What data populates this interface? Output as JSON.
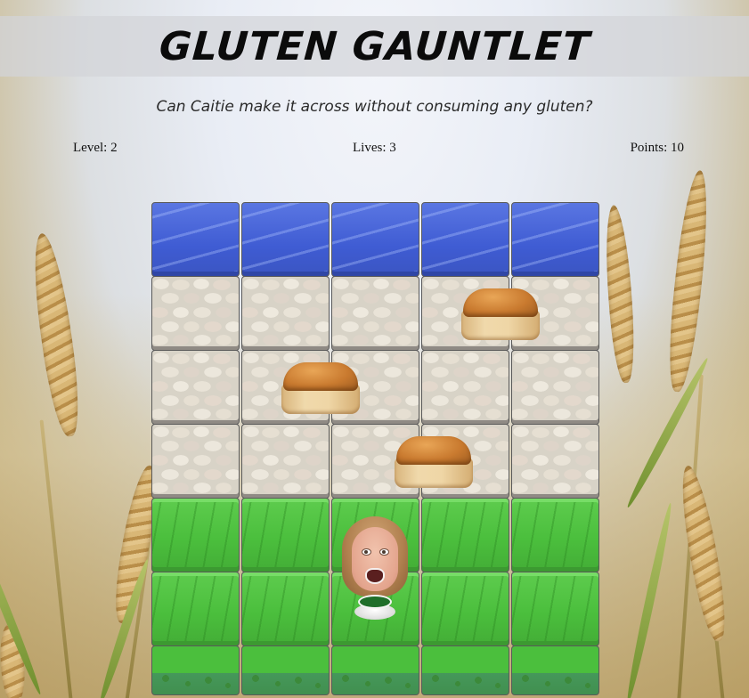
{
  "game": {
    "title": "Gluten Gauntlet",
    "subtitle": "Can Caitie make it across without consuming any gluten?"
  },
  "status": {
    "level": "Level: 2",
    "lives": "Lives: 3",
    "points": "Points: 10"
  },
  "board": {
    "columns": 5,
    "rows": [
      {
        "terrain": "water"
      },
      {
        "terrain": "stone"
      },
      {
        "terrain": "stone"
      },
      {
        "terrain": "stone"
      },
      {
        "terrain": "grass"
      },
      {
        "terrain": "grass"
      },
      {
        "terrain": "grass-edge"
      }
    ],
    "enemies": [
      {
        "name": "bread-loaf",
        "row": 1,
        "col": 3.45
      },
      {
        "name": "bread-loaf",
        "row": 2,
        "col": 1.45
      },
      {
        "name": "bread-loaf",
        "row": 3,
        "col": 2.7
      }
    ],
    "player": {
      "name": "caitie",
      "row": 5,
      "col": 2
    }
  },
  "colors": {
    "water": "#3f5cd3",
    "stone": "#d8d3c7",
    "grass": "#4bbf3d"
  }
}
